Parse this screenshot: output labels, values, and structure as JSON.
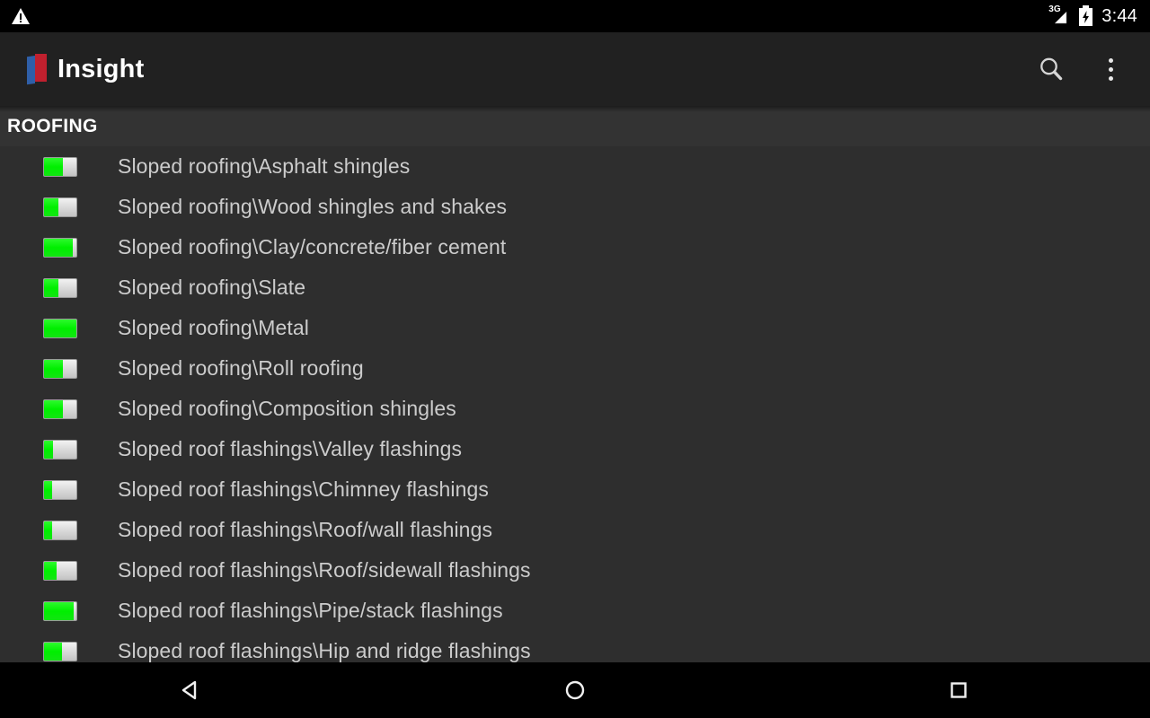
{
  "status_bar": {
    "warning_icon": "warning-triangle-icon",
    "network_label": "3G",
    "network_icon": "signal-bars-icon",
    "battery_icon": "battery-charging-icon",
    "time": "3:44"
  },
  "action_bar": {
    "logo_icon": "insight-book-logo",
    "title": "Insight",
    "search_icon": "search-icon",
    "overflow_icon": "overflow-menu-icon"
  },
  "section": {
    "header": "ROOFING"
  },
  "colors": {
    "status_bar_bg": "#000000",
    "action_bar_bg": "#212121",
    "content_bg": "#2e2e2e",
    "section_header_bg": "#333333",
    "gauge_fill": "#00ef00",
    "gauge_track": "#dcdcdc",
    "label_text": "#cccccc",
    "header_text": "#ffffff",
    "logo_blue": "#2f5fa8",
    "logo_red": "#c0202e"
  },
  "list": {
    "items": [
      {
        "label": "Sloped roofing\\Asphalt shingles",
        "progress": 57
      },
      {
        "label": "Sloped roofing\\Wood shingles and shakes",
        "progress": 44
      },
      {
        "label": "Sloped roofing\\Clay/concrete/fiber cement",
        "progress": 90
      },
      {
        "label": "Sloped roofing\\Slate",
        "progress": 45
      },
      {
        "label": "Sloped roofing\\Metal",
        "progress": 100
      },
      {
        "label": "Sloped roofing\\Roll roofing",
        "progress": 58
      },
      {
        "label": "Sloped roofing\\Composition shingles",
        "progress": 58
      },
      {
        "label": "Sloped roof flashings\\Valley flashings",
        "progress": 28
      },
      {
        "label": "Sloped roof flashings\\Chimney flashings",
        "progress": 25
      },
      {
        "label": "Sloped roof flashings\\Roof/wall flashings",
        "progress": 25
      },
      {
        "label": "Sloped roof flashings\\Roof/sidewall flashings",
        "progress": 38
      },
      {
        "label": "Sloped roof flashings\\Pipe/stack flashings",
        "progress": 92
      },
      {
        "label": "Sloped roof flashings\\Hip and ridge flashings",
        "progress": 55
      }
    ]
  },
  "nav_bar": {
    "back_icon": "back-triangle-icon",
    "home_icon": "home-circle-icon",
    "recents_icon": "recents-square-icon"
  }
}
